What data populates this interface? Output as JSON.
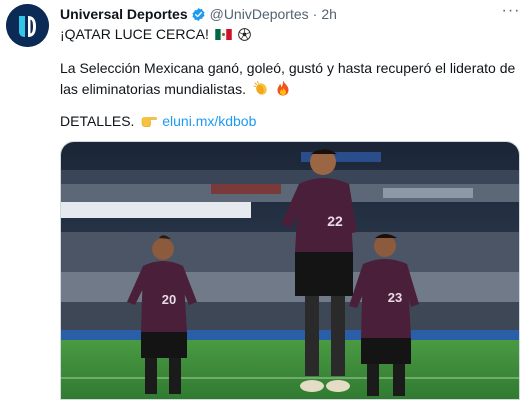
{
  "account": {
    "display_name": "Universal Deportes",
    "handle": "@UnivDeportes",
    "separator": "·",
    "time": "2h",
    "verified": true,
    "avatar_icon": "universal-deportes-logo",
    "avatar_color": "#0b2a55",
    "avatar_accent": "#34c6e8"
  },
  "tweet": {
    "headline": "¡QATAR LUCE CERCA!",
    "body_line_1": "La Selección Mexicana ganó, goleó, gustó y hasta recuperó el liderato de",
    "body_line_2": "las eliminatorias mundialistas.",
    "details_label": "DETALLES.",
    "link_text": "eluni.mx/kdbob",
    "emoji": [
      "mexico-flag-emoji",
      "soccer-ball-emoji",
      "clapping-hands-emoji",
      "fire-emoji",
      "backhand-pointing-right-emoji"
    ]
  },
  "media": {
    "type": "photo",
    "description_icon": "mexico-players-celebrating-photo",
    "jersey_numbers": [
      "20",
      "22",
      "23"
    ],
    "pitch_color": "#3a8a3a",
    "jersey_color": "#4a1f3a"
  },
  "menu": {
    "icon": "more-options-icon",
    "label": "···"
  },
  "colors": {
    "link": "#1d9bf0",
    "verified": "#1d9bf0",
    "muted": "#536471",
    "text": "#0f1419"
  }
}
